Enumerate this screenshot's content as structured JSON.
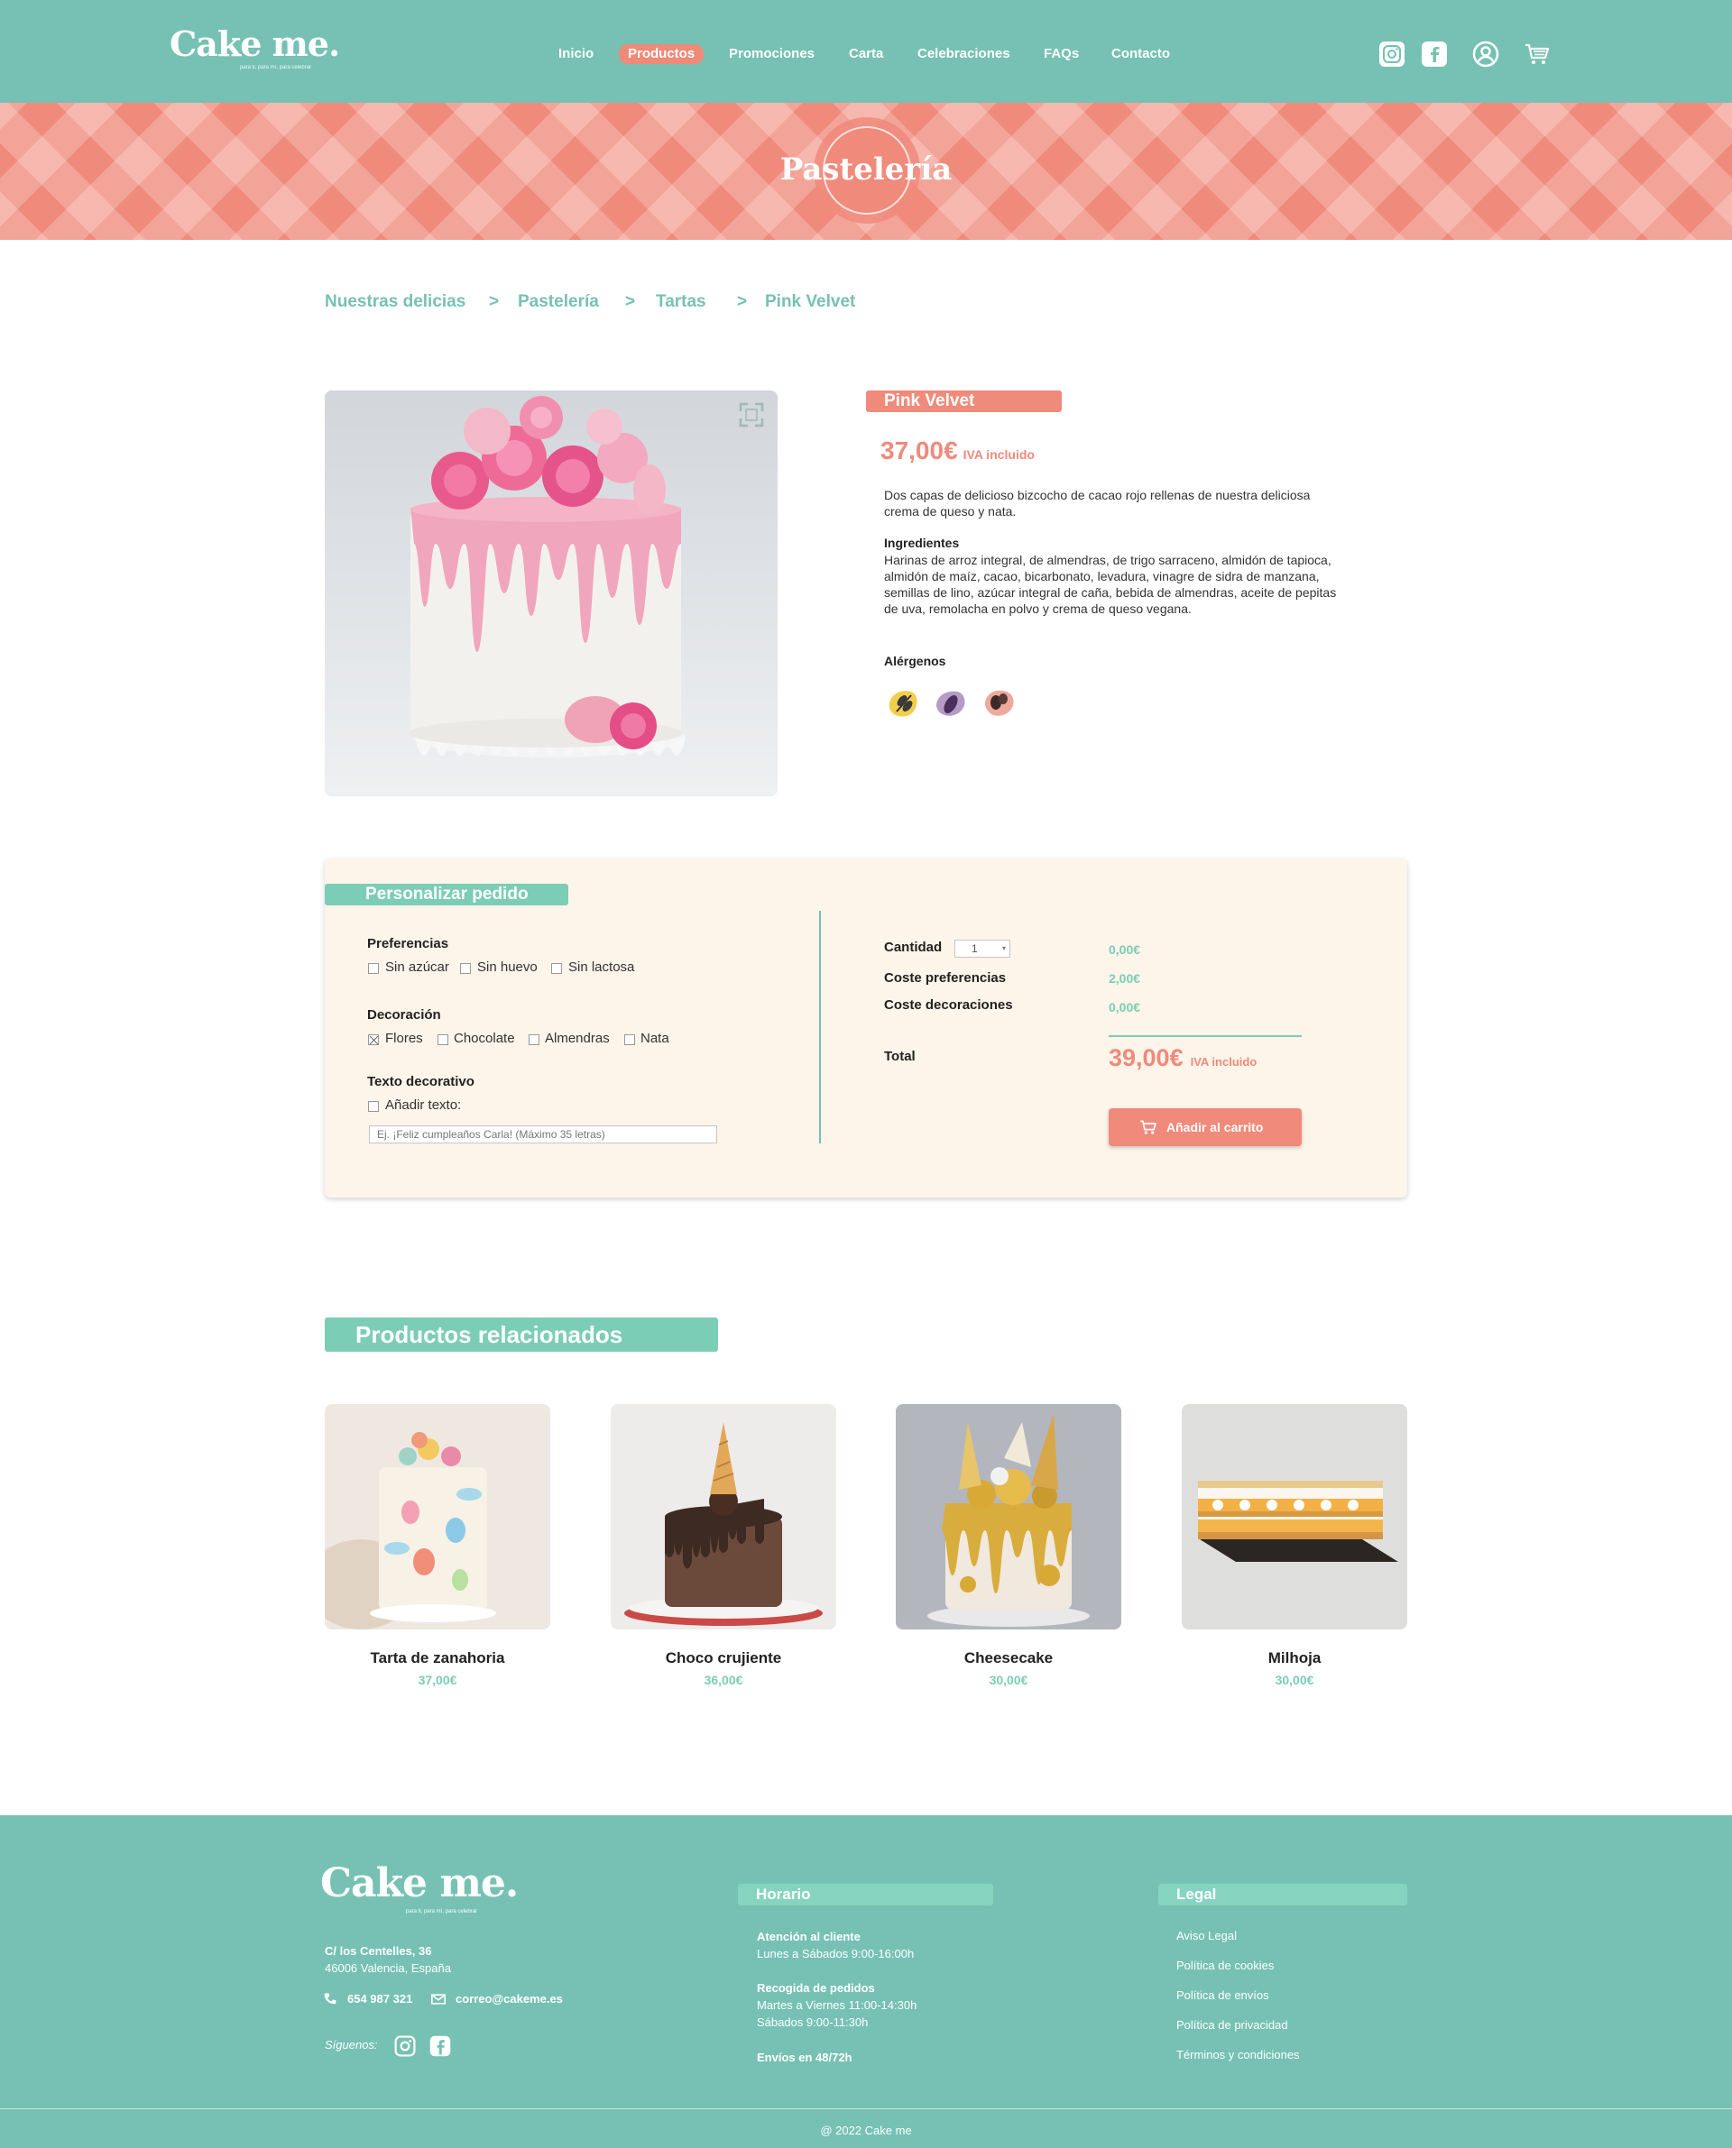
{
  "brand": {
    "name": "Cake me.",
    "tagline": "para ti, para mí, para celebrar"
  },
  "nav": {
    "items": [
      "Inicio",
      "Productos",
      "Promociones",
      "Carta",
      "Celebraciones",
      "FAQs",
      "Contacto"
    ],
    "active": "Productos"
  },
  "header_icons": [
    "instagram-icon",
    "facebook-icon",
    "user-icon",
    "cart-icon"
  ],
  "banner": {
    "title": "Pastelería"
  },
  "breadcrumb": {
    "items": [
      "Nuestras delicias",
      "Pastelería",
      "Tartas",
      "Pink Velvet"
    ],
    "separator": ">"
  },
  "product": {
    "name": "Pink Velvet",
    "price": "37,00€",
    "vat_note": "IVA incluido",
    "description": "Dos capas de delicioso bizcocho de cacao rojo rellenas de nuestra deliciosa crema de queso y nata.",
    "ingredients_label": "Ingredientes",
    "ingredients": "Harinas de arroz integral, de almendras, de trigo sarraceno, almidón de tapioca, almidón de maíz, cacao, bicarbonato, levadura, vinagre de sidra de manzana, semillas de lino, azúcar integral de caña, bebida de almendras, aceite de pepitas de uva, remolacha en polvo y crema de queso vegana.",
    "allergens_label": "Alérgenos",
    "allergens": [
      "gluten-icon",
      "soy-icon",
      "nuts-icon"
    ]
  },
  "customize": {
    "title": "Personalizar pedido",
    "preferences_label": "Preferencias",
    "preferences": [
      {
        "label": "Sin azúcar",
        "checked": false
      },
      {
        "label": "Sin huevo",
        "checked": false
      },
      {
        "label": "Sin lactosa",
        "checked": false
      }
    ],
    "decoration_label": "Decoración",
    "decorations": [
      {
        "label": "Flores",
        "checked": true
      },
      {
        "label": "Chocolate",
        "checked": false
      },
      {
        "label": "Almendras",
        "checked": false
      },
      {
        "label": "Nata",
        "checked": false
      }
    ],
    "text_label": "Texto decorativo",
    "add_text_label": "Añadir texto:",
    "add_text_checked": false,
    "text_placeholder": "Ej. ¡Feliz cumpleaños Carla! (Máximo 35 letras)",
    "quantity_label": "Cantidad",
    "quantity_value": "1",
    "quantity_price": "0,00€",
    "prefs_cost_label": "Coste preferencias",
    "prefs_cost": "2,00€",
    "deco_cost_label": "Coste decoraciones",
    "deco_cost": "0,00€",
    "total_label": "Total",
    "total": "39,00€",
    "total_vat": "IVA incluido",
    "add_to_cart": "Añadir al carrito"
  },
  "related": {
    "title": "Productos relacionados",
    "items": [
      {
        "name": "Tarta de zanahoria",
        "price": "37,00€"
      },
      {
        "name": "Choco crujiente",
        "price": "36,00€"
      },
      {
        "name": "Cheesecake",
        "price": "30,00€"
      },
      {
        "name": "Milhoja",
        "price": "30,00€"
      }
    ]
  },
  "footer": {
    "address_line1": "C/ los Centelles, 36",
    "address_line2": "46006 Valencia, España",
    "phone": "654 987 321",
    "email": "correo@cakeme.es",
    "follow": "Síguenos:",
    "schedule_title": "Horario",
    "attention_title": "Atención al cliente",
    "attention_hours": "Lunes a Sábados 9:00-16:00h",
    "pickup_title": "Recogida de pedidos",
    "pickup_hours_1": "Martes a Viernes 11:00-14:30h",
    "pickup_hours_2": "Sábados 9:00-11:30h",
    "shipping": "Envíos en 48/72h",
    "legal_title": "Legal",
    "legal_links": [
      "Aviso Legal",
      "Política de cookies",
      "Política de envíos",
      "Política de privacidad",
      "Términos y condiciones"
    ],
    "copyright": "@ 2022 Cake me"
  },
  "colors": {
    "teal": "#76c1b3",
    "mint": "#7ccdb5",
    "coral": "#f08a7b",
    "cream": "#fdf4ea"
  }
}
